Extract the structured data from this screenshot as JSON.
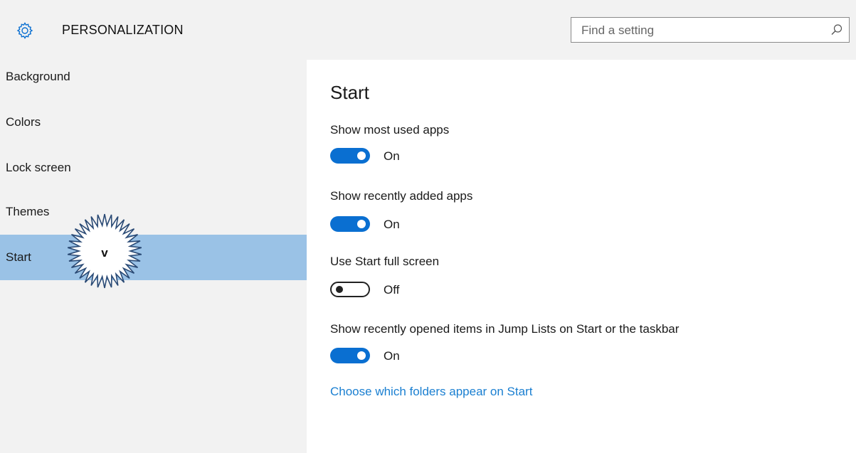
{
  "header": {
    "title": "PERSONALIZATION",
    "icon": "gear-icon",
    "search": {
      "placeholder": "Find a setting",
      "value": "",
      "icon": "search-icon"
    }
  },
  "sidebar": {
    "items": [
      {
        "label": "Background",
        "selected": false
      },
      {
        "label": "Colors",
        "selected": false
      },
      {
        "label": "Lock screen",
        "selected": false
      },
      {
        "label": "Themes",
        "selected": false
      },
      {
        "label": "Start",
        "selected": true
      }
    ],
    "annotation_mark": "v"
  },
  "main": {
    "title": "Start",
    "settings": [
      {
        "label": "Show most used apps",
        "state": "On"
      },
      {
        "label": "Show recently added apps",
        "state": "On"
      },
      {
        "label": "Use Start full screen",
        "state": "Off"
      },
      {
        "label": "Show recently opened items in Jump Lists on Start or the taskbar",
        "state": "On"
      }
    ],
    "link": "Choose which folders appear on Start"
  },
  "colors": {
    "accent": "#0a6fd1",
    "selected_nav": "#9ac2e6",
    "link": "#1a7fd1",
    "chrome": "#f2f2f2",
    "starburst_fill": "#ffffff",
    "starburst_stroke": "#2a4a75"
  }
}
